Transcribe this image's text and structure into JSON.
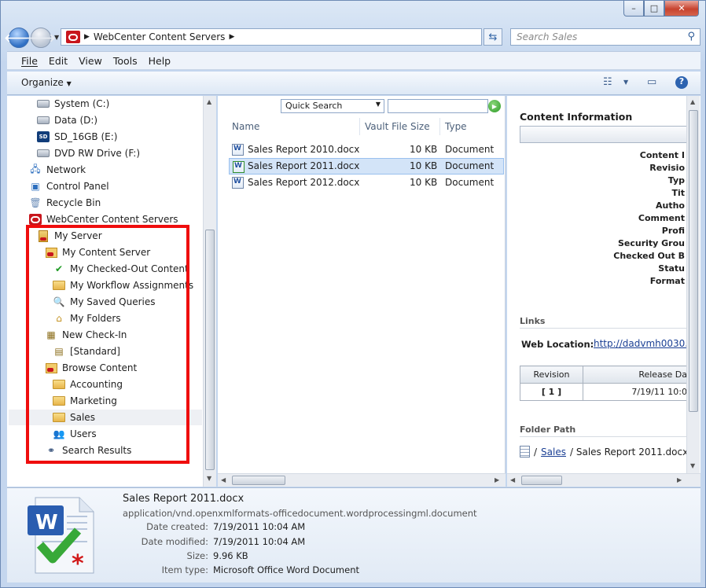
{
  "window": {
    "minimize": "–",
    "maximize": "□",
    "close": "✕"
  },
  "address": {
    "path": "WebCenter Content Servers",
    "search_placeholder": "Search Sales"
  },
  "menu": [
    "File",
    "Edit",
    "View",
    "Tools",
    "Help"
  ],
  "toolbar": {
    "organize": "Organize"
  },
  "tree": [
    {
      "label": "System (C:)",
      "icon": "drive-icon"
    },
    {
      "label": "Data (D:)",
      "icon": "drive-icon"
    },
    {
      "label": "SD_16GB (E:)",
      "icon": "sd-card-icon"
    },
    {
      "label": "DVD RW Drive (F:)",
      "icon": "dvd-drive-icon"
    },
    {
      "label": "Network",
      "icon": "network-icon"
    },
    {
      "label": "Control Panel",
      "icon": "control-panel-icon"
    },
    {
      "label": "Recycle Bin",
      "icon": "recycle-bin-icon"
    },
    {
      "label": "WebCenter Content Servers",
      "icon": "oracle-icon"
    },
    {
      "label": "My Server",
      "icon": "server-icon"
    },
    {
      "label": "My Content Server",
      "icon": "content-server-icon"
    },
    {
      "label": "My Checked-Out Content",
      "icon": "checkmark-icon"
    },
    {
      "label": "My Workflow Assignments",
      "icon": "workflow-folder-icon"
    },
    {
      "label": "My Saved Queries",
      "icon": "saved-query-icon"
    },
    {
      "label": "My Folders",
      "icon": "home-folder-icon"
    },
    {
      "label": "New Check-In",
      "icon": "checkin-icon"
    },
    {
      "label": "[Standard]",
      "icon": "form-icon"
    },
    {
      "label": "Browse Content",
      "icon": "content-server-icon"
    },
    {
      "label": "Accounting",
      "icon": "folder-icon"
    },
    {
      "label": "Marketing",
      "icon": "folder-icon"
    },
    {
      "label": "Sales",
      "icon": "folder-icon"
    },
    {
      "label": "Users",
      "icon": "users-icon"
    },
    {
      "label": "Search Results",
      "icon": "binoculars-icon"
    }
  ],
  "filelist": {
    "quick_search": "Quick Search",
    "columns": [
      "Name",
      "Vault File Size",
      "Type"
    ],
    "rows": [
      {
        "name": "Sales Report 2010.docx",
        "size": "10 KB",
        "type": "Document"
      },
      {
        "name": "Sales Report 2011.docx",
        "size": "10 KB",
        "type": "Document"
      },
      {
        "name": "Sales Report 2012.docx",
        "size": "10 KB",
        "type": "Document"
      }
    ]
  },
  "info": {
    "title": "Content Information",
    "labels": [
      "Content I",
      "Revisio",
      "Typ",
      "Tit",
      "Autho",
      "Comment",
      "Profi",
      "Security Grou",
      "Checked Out B",
      "Statu",
      "Format"
    ],
    "links_header": "Links",
    "web_location_label": "Web Location:",
    "web_location_value": "http://dadvmh0030.u",
    "rev_headers": [
      "Revision",
      "Release Da"
    ],
    "rev_row": [
      "[ 1 ]",
      "7/19/11 10:0"
    ],
    "folder_path_header": "Folder Path",
    "folder_sep": "/",
    "folder_link": "Sales",
    "folder_file": "/ Sales Report 2011.docx"
  },
  "details": {
    "name": "Sales Report 2011.docx",
    "mime": "application/vnd.openxmlformats-officedocument.wordprocessingml.document",
    "fields": [
      {
        "k": "Date created:",
        "v": "7/19/2011 10:04 AM"
      },
      {
        "k": "Date modified:",
        "v": "7/19/2011 10:04 AM"
      },
      {
        "k": "Size:",
        "v": "9.96 KB"
      },
      {
        "k": "Item type:",
        "v": "Microsoft Office Word Document"
      }
    ]
  }
}
